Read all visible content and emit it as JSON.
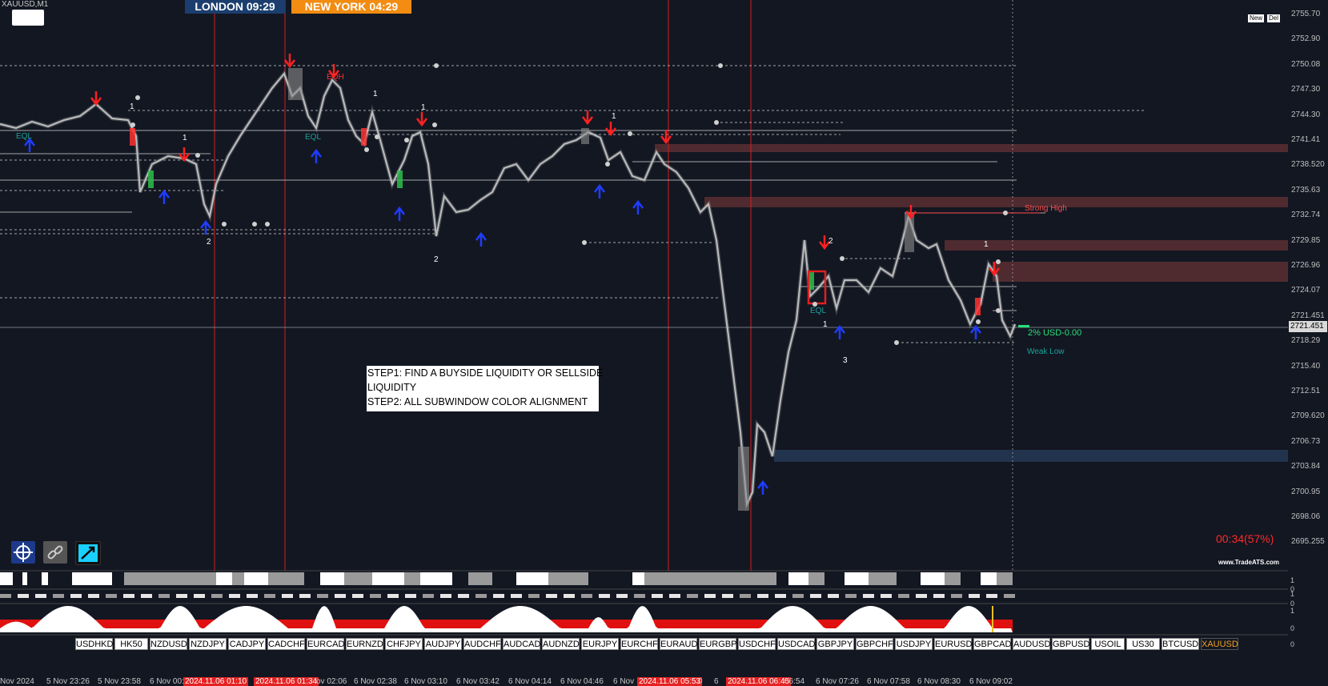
{
  "chart": {
    "symbol": "XAUUSD,M1",
    "sessions": {
      "london": "LONDON   09:29",
      "new_york": "NEW YORK  04:29"
    },
    "buttons": {
      "new": "New",
      "del": "Del"
    },
    "price_labels": [
      "2755.70",
      "2752.90",
      "2750.08",
      "2747.30",
      "2744.30",
      "2741.41",
      "2738.520",
      "2735.63",
      "2732.74",
      "2729.85",
      "2726.96",
      "2724.07",
      "2721.451",
      "2718.29",
      "2715.40",
      "2712.51",
      "2709.620",
      "2706.73",
      "2703.84",
      "2700.95",
      "2698.06",
      "2695.255"
    ],
    "current_price": "2721.451",
    "timer": "00:34(57%)",
    "brand": "www.TradeATS.com",
    "strong_high": "Strong High",
    "weak_low": "Weak Low",
    "eqh": "EQH",
    "eql": "EQL",
    "pnl_label": "2% USD-0.00",
    "note": {
      "line1": "STEP1: FIND A BUYSIDE LIQUIDITY OR SELLSIDE",
      "line2": "LIQUIDITY",
      "line3": "STEP2: ALL SUBWINDOW COLOR ALIGNMENT"
    },
    "swing_labels": [
      "1",
      "1",
      "1",
      "1",
      "2",
      "2",
      "1",
      "2",
      "1",
      "3",
      "1"
    ]
  },
  "subwindow_scales": {
    "w1": "1",
    "w1b": "0",
    "w2": "1",
    "w2b": "0",
    "w3": "1",
    "w3b": "0",
    "w4": "0"
  },
  "pairs": [
    "USDHKD",
    "HK50",
    "NZDUSD",
    "NZDJPY",
    "CADJPY",
    "CADCHF",
    "EURCAD",
    "EURNZD",
    "CHFJPY",
    "AUDJPY",
    "AUDCHF",
    "AUDCAD",
    "AUDNZD",
    "EURJPY",
    "EURCHF",
    "EURAUD",
    "EURGBP",
    "USDCHF",
    "USDCAD",
    "GBPJPY",
    "GBPCHF",
    "USDJPY",
    "EURUSD",
    "GBPCAD",
    "AUDUSD",
    "GBPUSD",
    "USOIL",
    "US30",
    "BTCUSD",
    "XAUUSD"
  ],
  "active_pair": "XAUUSD",
  "time_axis": [
    {
      "label": "Nov 2024",
      "highlight": false
    },
    {
      "label": "5 Nov 23:26",
      "highlight": false
    },
    {
      "label": "5 Nov 23:58",
      "highlight": false
    },
    {
      "label": "6 Nov 00:",
      "highlight": false
    },
    {
      "label": "2024.11.06 01:10",
      "highlight": true
    },
    {
      "label": "2024.11.06 01:34",
      "highlight": true
    },
    {
      "label": "ov 02:06",
      "highlight": false
    },
    {
      "label": "6 Nov 02:38",
      "highlight": false
    },
    {
      "label": "6 Nov 03:10",
      "highlight": false
    },
    {
      "label": "6 Nov 03:42",
      "highlight": false
    },
    {
      "label": "6 Nov 04:14",
      "highlight": false
    },
    {
      "label": "6 Nov 04:46",
      "highlight": false
    },
    {
      "label": "6 Nov",
      "highlight": false
    },
    {
      "label": "2024.11.06 05:53",
      "highlight": true
    },
    {
      "label": "0",
      "highlight": false
    },
    {
      "label": "6",
      "highlight": false
    },
    {
      "label": "2024.11.06 06:45",
      "highlight": true
    },
    {
      "label": "06:54",
      "highlight": false
    },
    {
      "label": "6 Nov 07:26",
      "highlight": false
    },
    {
      "label": "6 Nov 07:58",
      "highlight": false
    },
    {
      "label": "6 Nov 08:30",
      "highlight": false
    },
    {
      "label": "6 Nov 09:02",
      "highlight": false
    }
  ],
  "tools": [
    "crosshair-tool",
    "link-tool",
    "trendline-tool"
  ],
  "colors": {
    "background": "#131722",
    "bull": "#ffffff",
    "bear": "#8c8c8c",
    "sell_arrow": "#ff2020",
    "buy_arrow": "#1f3cff",
    "zone_supply": "#5a2f33",
    "zone_demand": "#263a55"
  }
}
